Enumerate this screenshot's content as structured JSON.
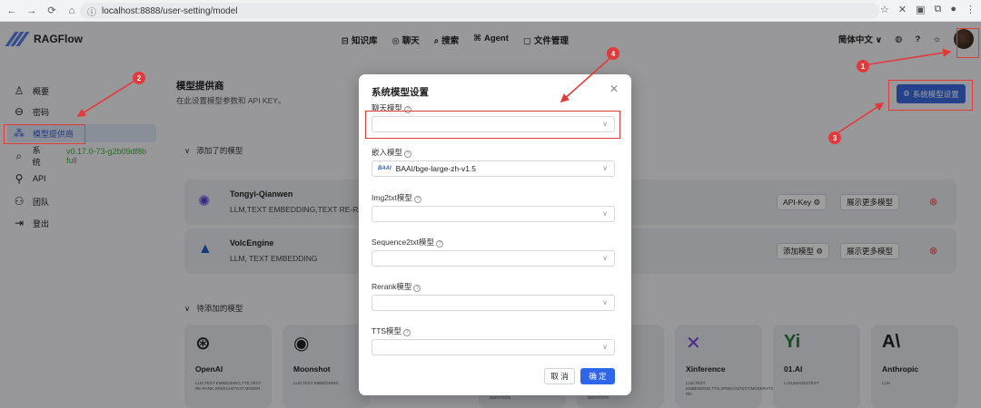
{
  "browser": {
    "url": "localhost:8888/user-setting/model",
    "nav": [
      "←",
      "→",
      "C",
      "⌂"
    ]
  },
  "app": {
    "name": "RAGFlow",
    "nav": [
      {
        "icon": "⊟",
        "label": "知识库"
      },
      {
        "icon": "◎",
        "label": "聊天"
      },
      {
        "icon": "⌕",
        "label": "搜索"
      },
      {
        "icon": "⌘",
        "label": "Agent"
      },
      {
        "icon": "▢",
        "label": "文件管理"
      }
    ],
    "language": "简体中文 ∨"
  },
  "sidebar": {
    "items": [
      {
        "label": "概要",
        "icon": "person-icon"
      },
      {
        "label": "密码",
        "icon": "lock-icon"
      },
      {
        "label": "模型提供商",
        "icon": "model-icon"
      },
      {
        "label": "系统",
        "icon": "system-icon"
      },
      {
        "label": "API",
        "icon": "api-icon"
      },
      {
        "label": "团队",
        "icon": "team-icon"
      },
      {
        "label": "登出",
        "icon": "logout-icon"
      }
    ],
    "version": "v0.17.0-73-g2b09df8b full"
  },
  "main": {
    "title": "模型提供商",
    "subtitle": "在此设置模型参数和 API KEY。",
    "system_settings_button": "系统模型设置",
    "added_label": "添加了的模型",
    "pending_label": "待添加的模型",
    "providers": [
      {
        "name": "Tongyi-Qianwen",
        "tags": "LLM,TEXT EMBEDDING,TEXT RE-RANK",
        "btn1": "API-Key ⚙",
        "btn2": "展示更多模型"
      },
      {
        "name": "VolcEngine",
        "tags": "LLM, TEXT EMBEDDING",
        "btn1": "添加模型 ⚙",
        "btn2": "展示更多模型"
      }
    ],
    "models": [
      {
        "name": "OpenAI",
        "logo": "⊛",
        "tags": "LLM,TEXT EMBEDDING,TTS,TEXT RE-RANK,SPEECH2TEXT,MODER"
      },
      {
        "name": "Moonshot",
        "logo": "◉",
        "tags": "LLM,TEXT EMBEDDING"
      },
      {
        "name": "",
        "logo": "",
        "tags": "DERATION"
      },
      {
        "name": "",
        "logo": "",
        "tags": "DERATION"
      },
      {
        "name": "Xinference",
        "logo": "✕",
        "tags": "LLM,TEXT EMBEDDING,TTS,SPEECH2TEXT,MODERATION,TEXT RE-"
      },
      {
        "name": "01.AI",
        "logo": "Yi",
        "tags": "LLM,IMAGE2TEXT"
      },
      {
        "name": "Anthropic",
        "logo": "A\\",
        "tags": "LLM"
      }
    ]
  },
  "modal": {
    "title": "系统模型设置",
    "fields": [
      {
        "label": "聊天模型",
        "value": ""
      },
      {
        "label": "嵌入模型",
        "value": "BAAI/bge-large-zh-v1.5",
        "logo": "BAAI"
      },
      {
        "label": "Img2txt模型",
        "value": ""
      },
      {
        "label": "Sequence2txt模型",
        "value": ""
      },
      {
        "label": "Rerank模型",
        "value": ""
      },
      {
        "label": "TTS模型",
        "value": ""
      }
    ],
    "cancel": "取 消",
    "ok": "确 定"
  },
  "annotations": {
    "badges": [
      "1",
      "2",
      "3",
      "4"
    ],
    "color": "#e23a3a"
  }
}
